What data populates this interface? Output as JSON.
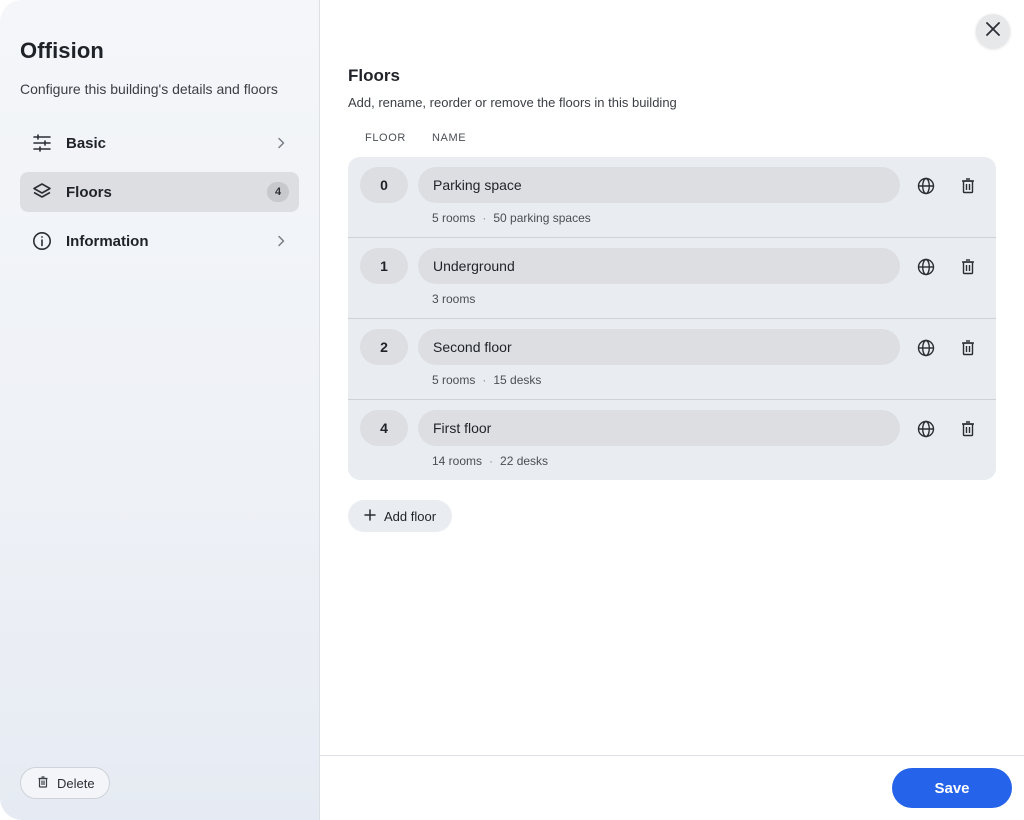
{
  "sidebar": {
    "title": "Offision",
    "subtitle": "Configure this building's details and floors",
    "items": [
      {
        "label": "Basic",
        "icon": "sliders-icon"
      },
      {
        "label": "Floors",
        "icon": "layers-icon",
        "badge": "4"
      },
      {
        "label": "Information",
        "icon": "info-icon"
      }
    ],
    "delete_label": "Delete"
  },
  "main": {
    "title": "Floors",
    "subtitle": "Add, rename, reorder or remove the floors in this building",
    "headers": {
      "floor": "FLOOR",
      "name": "NAME"
    },
    "floors": [
      {
        "number": "0",
        "name": "Parking space",
        "meta": [
          "5 rooms",
          "50 parking spaces"
        ]
      },
      {
        "number": "1",
        "name": "Underground",
        "meta": [
          "3 rooms"
        ]
      },
      {
        "number": "2",
        "name": "Second floor",
        "meta": [
          "5 rooms",
          "15 desks"
        ]
      },
      {
        "number": "4",
        "name": "First floor",
        "meta": [
          "14 rooms",
          "22 desks"
        ]
      }
    ],
    "add_floor_label": "Add floor"
  },
  "footer": {
    "save_label": "Save"
  },
  "colors": {
    "accent": "#2563eb",
    "row_bg": "#e9ecf0",
    "active_nav": "#dcdee2"
  }
}
